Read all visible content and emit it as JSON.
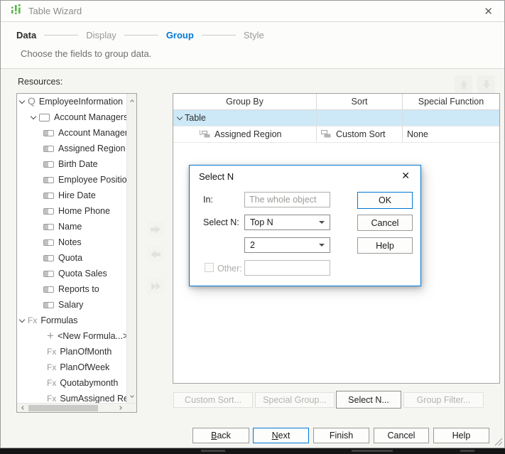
{
  "window": {
    "title": "Table Wizard"
  },
  "icons": {
    "close_glyph": "✕",
    "query_glyph": "Q",
    "formula_glyph": "Fx",
    "new_formula_glyph": "+"
  },
  "steps": {
    "data": "Data",
    "display": "Display",
    "group": "Group",
    "style": "Style"
  },
  "subtitle": "Choose the fields to group data.",
  "resources": {
    "label": "Resources:",
    "tree": [
      {
        "label": "EmployeeInformation"
      },
      {
        "label": "Account Managers"
      },
      {
        "label": "Account Managers I"
      },
      {
        "label": "Assigned Region"
      },
      {
        "label": "Birth Date"
      },
      {
        "label": "Employee Position"
      },
      {
        "label": "Hire Date"
      },
      {
        "label": "Home Phone"
      },
      {
        "label": "Name"
      },
      {
        "label": "Notes"
      },
      {
        "label": "Quota"
      },
      {
        "label": "Quota Sales"
      },
      {
        "label": "Reports to"
      },
      {
        "label": "Salary"
      },
      {
        "label": "Formulas"
      },
      {
        "label": "<New Formula...>"
      },
      {
        "label": "PlanOfMonth"
      },
      {
        "label": "PlanOfWeek"
      },
      {
        "label": "Quotabymonth"
      },
      {
        "label": "SumAssigned Region"
      }
    ]
  },
  "group_table": {
    "columns": [
      "Group By",
      "Sort",
      "Special Function"
    ],
    "rows": [
      {
        "group_by": "Table",
        "sort": "",
        "special_function": ""
      },
      {
        "group_by": "Assigned Region",
        "sort": "Custom Sort",
        "special_function": "None"
      }
    ]
  },
  "select_n_dialog": {
    "title": "Select N",
    "fields": {
      "in_label": "In:",
      "in_value": "The whole object",
      "select_n_label": "Select N:",
      "select_n_value": "Top N",
      "n_value": "2",
      "other_label": "Other:",
      "other_value": ""
    },
    "buttons": {
      "ok": "OK",
      "cancel": "Cancel",
      "help": "Help"
    }
  },
  "group_actions": {
    "custom_sort": "Custom Sort...",
    "special_group": "Special Group...",
    "select_n": "Select N...",
    "group_filter": "Group Filter..."
  },
  "wizard_actions": {
    "back": "Back",
    "next": "Next",
    "finish": "Finish",
    "cancel": "Cancel",
    "help": "Help"
  }
}
